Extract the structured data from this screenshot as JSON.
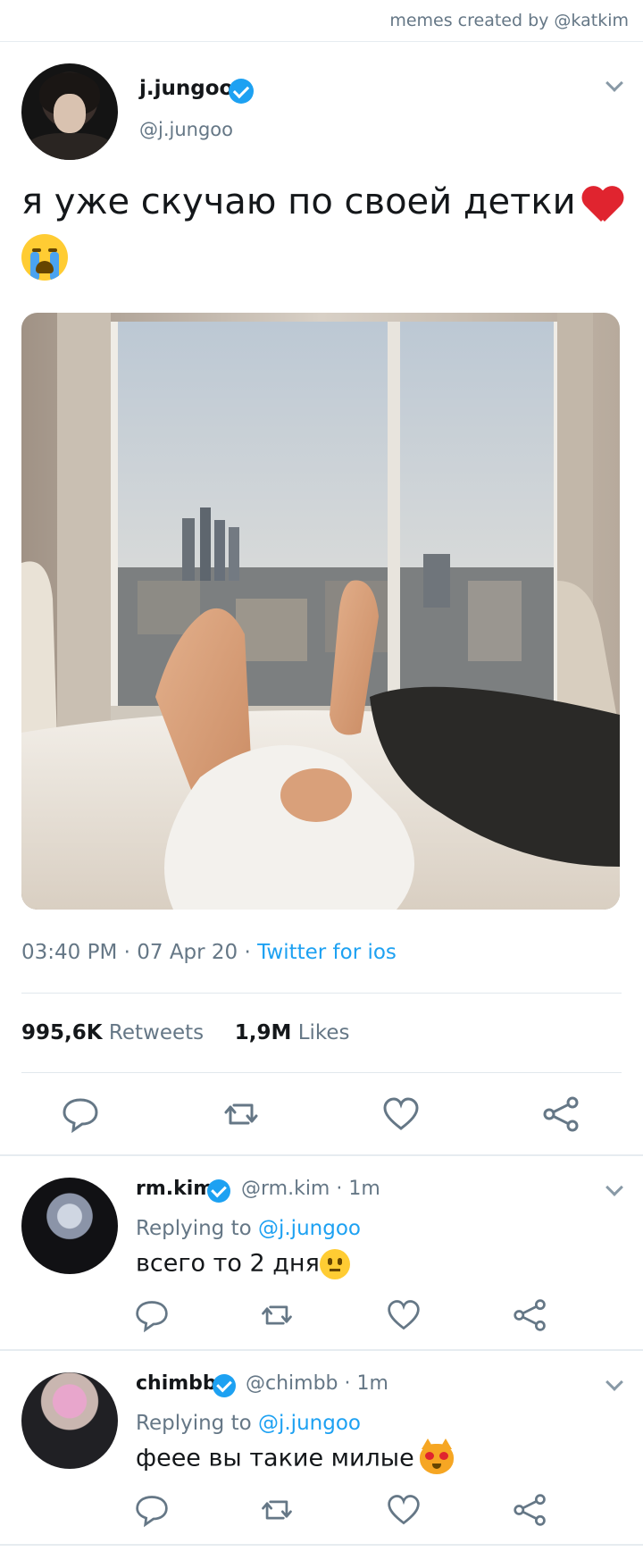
{
  "credit": "memes created by @katkim",
  "tweet": {
    "display_name": "j.jungoo",
    "handle": "@j.jungoo",
    "text": "я уже скучаю по своей детки",
    "emoji_after_text": [
      "red-heart",
      "loudly-crying-face"
    ],
    "time": "03:40 PM",
    "date": "07 Apr 20",
    "client": "Twitter for ios",
    "retweets_count": "995,6K",
    "retweets_label": "Retweets",
    "likes_count": "1,9M",
    "likes_label": "Likes",
    "actions": [
      "reply-icon",
      "retweet-icon",
      "like-icon",
      "share-icon"
    ]
  },
  "replies": [
    {
      "display_name": "rm.kim",
      "handle": "@rm.kim",
      "age": "1m",
      "replying_prefix": "Replying to",
      "replying_to": "@j.jungoo",
      "text": "всего то 2 дня",
      "emoji": "face-with-open-mouth"
    },
    {
      "display_name": "chimbb",
      "handle": "@chimbb",
      "age": "1m",
      "replying_prefix": "Replying to",
      "replying_to": "@j.jungoo",
      "text": "фeee вы такие милые",
      "emoji": "heart-eyes-cat"
    }
  ],
  "colors": {
    "accent": "#1da1f2",
    "text": "#14171a",
    "muted": "#657786",
    "divider": "#e6ecf0",
    "heart": "#e0242f"
  }
}
